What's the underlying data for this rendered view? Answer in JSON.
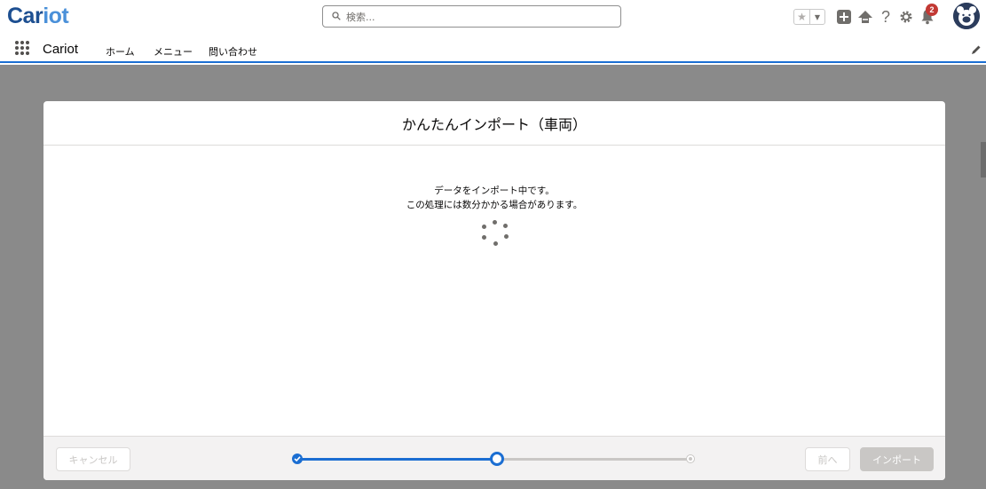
{
  "header": {
    "logo_part1": "Car",
    "logo_part2": "iot",
    "search_placeholder": "検索...",
    "notification_count": "2",
    "help_glyph": "?"
  },
  "nav": {
    "app_name": "Cariot",
    "items": [
      {
        "label": "ホーム"
      },
      {
        "label": "メニュー"
      },
      {
        "label": "問い合わせ"
      }
    ]
  },
  "modal": {
    "title": "かんたんインポート（車両）",
    "status_line_1": "データをインポート中です。",
    "status_line_2": "この処理には数分かかる場合があります。",
    "cancel_label": "キャンセル",
    "prev_label": "前へ",
    "import_label": "インポート",
    "progress": {
      "steps_total": 3,
      "current_step": 2,
      "completed_steps": 1
    }
  },
  "colors": {
    "brand_dark": "#1d4f91",
    "brand_light": "#4a90d9",
    "accent": "#1b6ed2",
    "badge": "#c23934",
    "backdrop": "#8a8a8a"
  }
}
